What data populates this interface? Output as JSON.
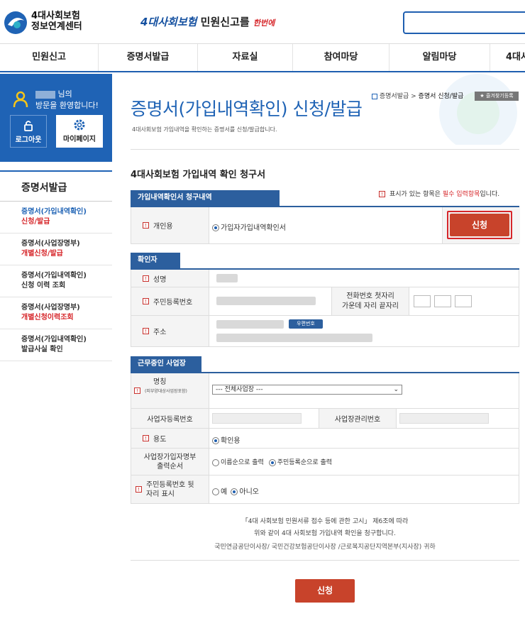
{
  "header": {
    "logo_line1": "4대사회보험",
    "logo_line2": "정보연계센터",
    "slogan_part1": "4대사회보험",
    "slogan_part2": "민원신고를",
    "slogan_part3": "한번에",
    "search_placeholder": ""
  },
  "gnb": {
    "items": [
      "민원신고",
      "증명서발급",
      "자료실",
      "참여마당",
      "알림마당",
      "4대사"
    ]
  },
  "welcome": {
    "suffix": "님의",
    "line2": "방문을 환영합니다!",
    "logout": "로그아웃",
    "mypage": "마이페이지"
  },
  "lnb": {
    "title": "증명서발급",
    "items": [
      {
        "line1": "증명서(가입내역확인)",
        "line2": "신청/발급"
      },
      {
        "line1": "증명서(사업장명부)",
        "line2": "개별신청/발급"
      },
      {
        "line1": "증명서(가입내역확인)",
        "line2": "신청 이력 조회"
      },
      {
        "line1": "증명서(사업장명부)",
        "line2": "개별신청이력조회"
      },
      {
        "line1": "증명서(가입내역확인)",
        "line2": "발급사실 확인"
      }
    ]
  },
  "page": {
    "title": "증명서(가입내역확인) 신청/발급",
    "subtitle": "4대사회보험 가입내역을 확인하는 증명서를 신청/발급합니다.",
    "breadcrumb_1": "증명서발급",
    "breadcrumb_2": "증명서 신청/발급",
    "favorite": "즐겨찾기등록",
    "form_title": "4대사회보험 가입내역 확인 청구서",
    "required_note_prefix": "표시가 있는 항목은",
    "required_note_red": "필수 입력항목",
    "required_note_suffix": "입니다."
  },
  "section1": {
    "header": "가입내역확인서 청구내역",
    "label": "개인용",
    "option": "가입자가입내역확인서",
    "apply_button": "신청"
  },
  "section2": {
    "header": "확인자",
    "name_label": "성명",
    "rrn_label": "주민등록번호",
    "phone_label_1": "전화번호 첫자리",
    "phone_label_2": "가운데 자리 끝자리",
    "address_label": "주소",
    "zip_button": "우편번호"
  },
  "section3": {
    "header": "근무중인 사업장",
    "company_label": "명칭",
    "company_note": "(피부양대상사업장포함)",
    "company_select": "--- 전체사업장 ---",
    "biz_no_label": "사업자등록번호",
    "mgmt_no_label": "사업장관리번호",
    "purpose_label": "용도",
    "purpose_option": "확인용",
    "order_label_1": "사업장가입자명부",
    "order_label_2": "출력순서",
    "order_option_1": "이름순으로 출력",
    "order_option_2": "주민등록순으로 출력",
    "rrn_back_label_1": "주민등록번호 뒷",
    "rrn_back_label_2": "자리 표시",
    "yes": "예",
    "no": "아니오"
  },
  "notice": {
    "line1": "「4대 사회보험 민원서류 접수 등에 관한 고시」 제6조에 따라",
    "line2": "위와 같이 4대 사회보험 가입내역 확인을 청구합니다.",
    "line3": "국민연금공단이사장/ 국민건강보험공단이사장 /근로복지공단지역본부(지사장) 귀하"
  },
  "submit_button": "신청",
  "colors": {
    "primary_blue": "#1f63b5",
    "section_blue": "#2c5f9e",
    "button_red": "#c8432b",
    "required_red": "#d6262a"
  }
}
